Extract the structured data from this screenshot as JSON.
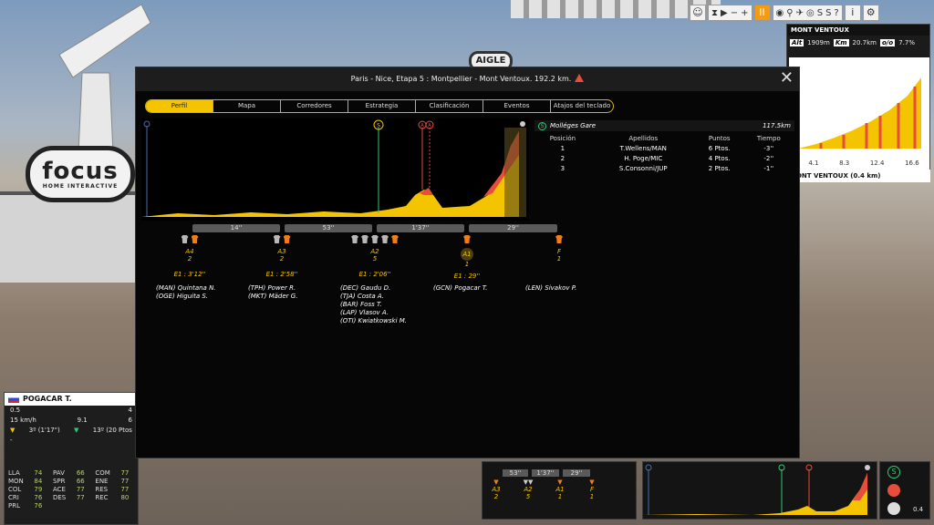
{
  "scenery": {
    "focus_brand": "focus",
    "focus_sub": "HOME INTERACTIVE",
    "sponsor": "AIGLE"
  },
  "toolbar": {
    "help": "?",
    "info": "i",
    "pause": "II",
    "minus": "−",
    "plus": "+",
    "s1": "S",
    "s2": "S"
  },
  "mini_profile": {
    "title": "MONT VENTOUX",
    "alt_label": "Alt",
    "alt_value": "1909m",
    "km_label": "Km",
    "km_value": "20.7km",
    "grade_label": "o/o",
    "grade_value": "7.7%",
    "ticks": [
      "4.1",
      "8.3",
      "12.4",
      "16.6"
    ],
    "footer": "MONT VENTOUX (0.4 km)"
  },
  "rider": {
    "name": "POGACAR T.",
    "r1_left": "0.5",
    "r1_right": "4",
    "r2_left": "15",
    "r2_unit": "km/h",
    "r2_mid": "9.1",
    "r2_right": "6",
    "gc": "3º (1'17\")",
    "points": "13º (20 Ptos",
    "other": "-",
    "attributes": [
      {
        "k": "LLA",
        "v": "74"
      },
      {
        "k": "PAV",
        "v": "66"
      },
      {
        "k": "COM",
        "v": "77"
      },
      {
        "k": "MON",
        "v": "84"
      },
      {
        "k": "SPR",
        "v": "66"
      },
      {
        "k": "ENE",
        "v": "77"
      },
      {
        "k": "COL",
        "v": "79"
      },
      {
        "k": "ACE",
        "v": "77"
      },
      {
        "k": "RES",
        "v": "77"
      },
      {
        "k": "CRI",
        "v": "76"
      },
      {
        "k": "DES",
        "v": "77"
      },
      {
        "k": "REC",
        "v": "80"
      },
      {
        "k": "PRL",
        "v": "76"
      }
    ]
  },
  "modal": {
    "title": "Paris - Nice, Etapa 5 : Montpellier - Mont Ventoux. 192.2 km.",
    "close": "✕",
    "tabs": [
      "Perfil",
      "Mapa",
      "Corredores",
      "Estrategia",
      "Clasificación",
      "Eventos",
      "Atajos del teclado"
    ],
    "active_tab": "Perfil"
  },
  "profile": {
    "marker_labels": [
      "S",
      "A",
      "A"
    ],
    "segments": [
      {
        "label": "14''"
      },
      {
        "label": "53''"
      },
      {
        "label": "1'37''"
      },
      {
        "label": "29''"
      }
    ],
    "groups": [
      {
        "name": "A4",
        "count": "2",
        "gap": "E1 : 3'12''",
        "riders": [
          "(MAN) Quintana N.",
          "(OGE) Higuita S."
        ],
        "jerseys": [
          "g",
          "o"
        ]
      },
      {
        "name": "A3",
        "count": "2",
        "gap": "E1 : 2'58''",
        "riders": [
          "(TPH) Power R.",
          "(MKT) Mäder G."
        ],
        "jerseys": [
          "g",
          "o"
        ]
      },
      {
        "name": "A2",
        "count": "5",
        "gap": "E1 : 2'06''",
        "riders": [
          "(DEC) Gaudu D.",
          "(TJA) Costa A.",
          "(BAR) Foss T.",
          "(LAP) Vlasov A.",
          "(OTI) Kwiatkowski M."
        ],
        "jerseys": [
          "g",
          "g",
          "g",
          "g",
          "o"
        ]
      },
      {
        "name": "A1",
        "count": "1",
        "gap": "E1 : 29''",
        "riders": [
          "(GCN) Pogacar T."
        ],
        "jerseys": [
          "o"
        ]
      },
      {
        "name": "F",
        "count": "1",
        "gap": "",
        "riders": [
          "(LEN) Sivakov P."
        ],
        "jerseys": [
          "o"
        ]
      }
    ]
  },
  "sprint_result": {
    "name": "Molléges Gare",
    "distance": "117.5km",
    "headers": [
      "Posición",
      "Apellidos",
      "Puntos",
      "Tiempo"
    ],
    "rows": [
      [
        "1",
        "T.Wellens/MAN",
        "6 Ptos.",
        "-3''"
      ],
      [
        "2",
        "H. Poge/MIC",
        "4 Ptos.",
        "-2''"
      ],
      [
        "3",
        "S.Consonni/JUP",
        "2 Ptos.",
        "-1''"
      ]
    ]
  },
  "bottom_hud": {
    "segments": [
      "53''",
      "1'37''",
      "29''"
    ],
    "groups": [
      {
        "name": "A3",
        "count": "2"
      },
      {
        "name": "A2",
        "count": "5"
      },
      {
        "name": "A1",
        "count": "1"
      },
      {
        "name": "F",
        "count": "1"
      }
    ],
    "right_value": "0.4"
  },
  "colors": {
    "accent": "#f5c400",
    "sprint": "#2ecc71",
    "climb": "#e74c3c",
    "jersey_orange": "#ef7d1a"
  }
}
